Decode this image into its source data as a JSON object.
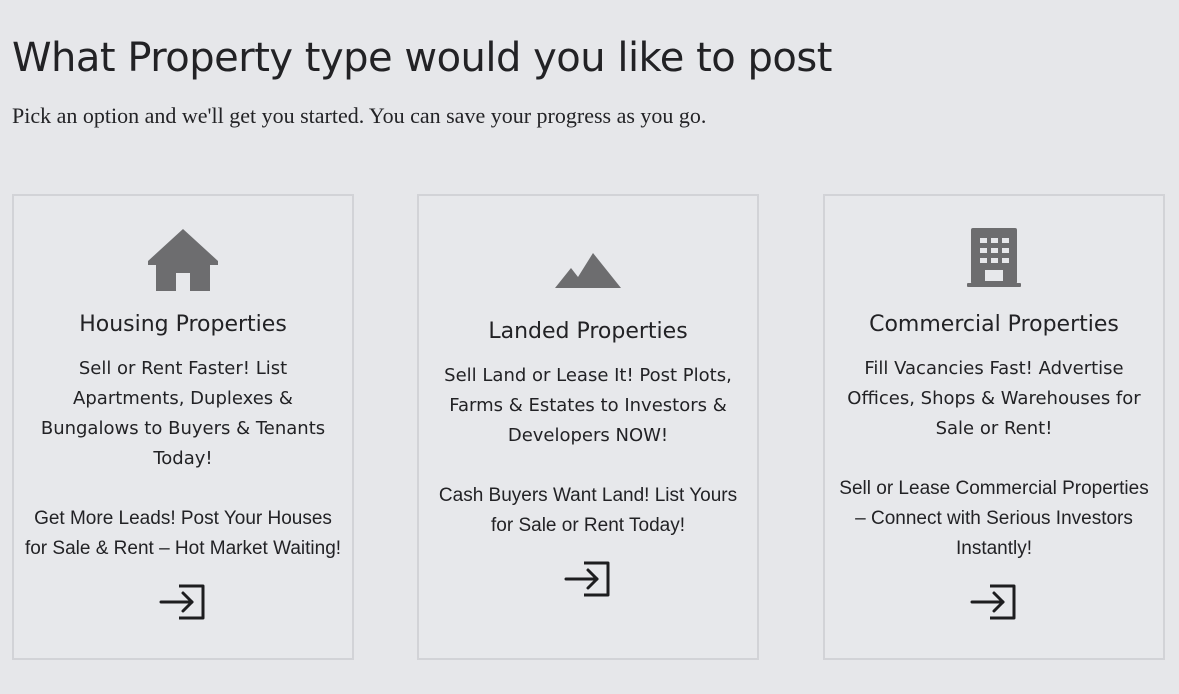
{
  "header": {
    "title": "What Property type would you like to post",
    "subtitle": "Pick an option and we'll get you started. You can save your progress as you go."
  },
  "cards": [
    {
      "icon": "house-icon",
      "title": "Housing Properties",
      "description": "Sell or Rent Faster! List Apartments, Duplexes & Bungalows to Buyers & Tenants Today!",
      "extra": "Get More Leads! Post Your Houses for Sale & Rent – Hot Market Waiting!",
      "action_icon": "enter-icon"
    },
    {
      "icon": "mountains-icon",
      "title": "Landed Properties",
      "description": "Sell Land or Lease It! Post Plots, Farms & Estates to Investors & Developers NOW!",
      "extra": "Cash Buyers Want Land! List Yours for Sale or Rent Today!",
      "action_icon": "enter-icon"
    },
    {
      "icon": "building-icon",
      "title": "Commercial Properties",
      "description": "Fill Vacancies Fast! Advertise Offices, Shops & Warehouses for Sale or Rent!",
      "extra": "Sell or Lease Commercial Properties – Connect with Serious Investors Instantly!",
      "action_icon": "enter-icon"
    }
  ],
  "colors": {
    "background": "#e6e7ea",
    "card_border": "#d2d3d7",
    "icon_gray": "#6d6d6f",
    "text": "#222225"
  }
}
